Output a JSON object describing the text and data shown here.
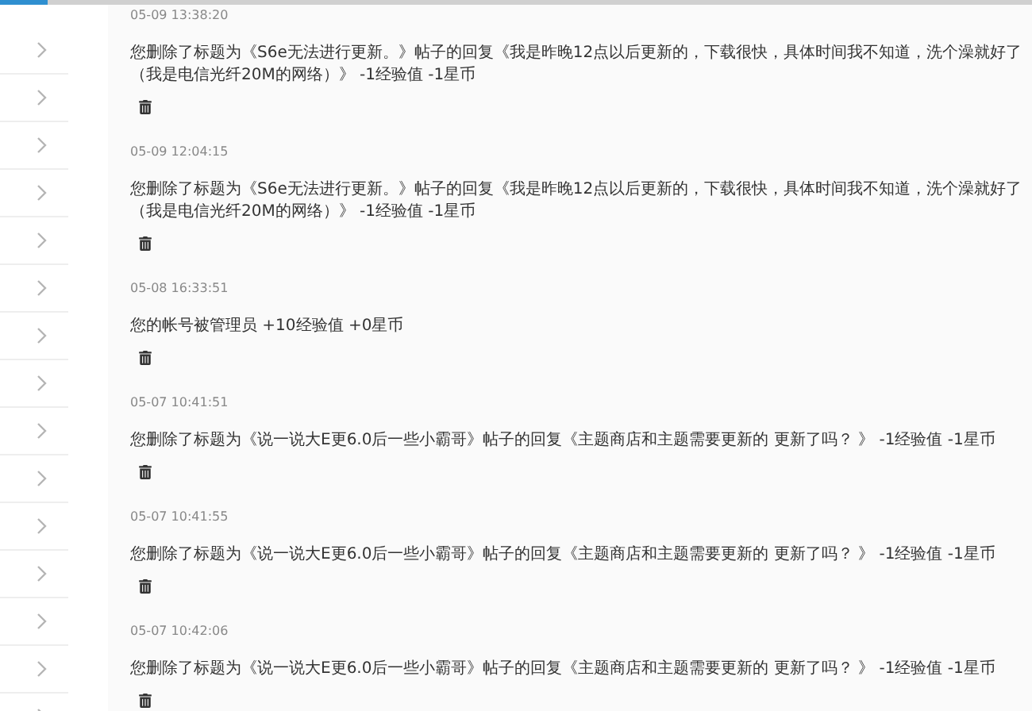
{
  "sidebar": {
    "items": [
      {
        "kind": "chevron"
      },
      {
        "kind": "chevron"
      },
      {
        "kind": "chevron"
      },
      {
        "kind": "chevron"
      },
      {
        "kind": "chevron"
      },
      {
        "kind": "chevron"
      },
      {
        "kind": "chevron"
      },
      {
        "kind": "chevron"
      },
      {
        "kind": "chevron"
      },
      {
        "kind": "chevron"
      },
      {
        "kind": "chevron"
      },
      {
        "kind": "chevron"
      },
      {
        "kind": "chevron"
      },
      {
        "kind": "chevron"
      },
      {
        "kind": "chevron"
      }
    ]
  },
  "entries": [
    {
      "time": "05-09 13:38:20",
      "text": "您删除了标题为《S6e无法进行更新。》帖子的回复《我是昨晚12点以后更新的，下载很快，具体时间我不知道，洗个澡就好了（我是电信光纤20M的网络）》 -1经验值 -1星币"
    },
    {
      "time": "05-09 12:04:15",
      "text": "您删除了标题为《S6e无法进行更新。》帖子的回复《我是昨晚12点以后更新的，下载很快，具体时间我不知道，洗个澡就好了（我是电信光纤20M的网络）》 -1经验值 -1星币"
    },
    {
      "time": "05-08 16:33:51",
      "text": "您的帐号被管理员 +10经验值 +0星币"
    },
    {
      "time": "05-07 10:41:51",
      "text": "您删除了标题为《说一说大E更6.0后一些小霸哥》帖子的回复《主题商店和主题需要更新的 更新了吗？ 》 -1经验值 -1星币"
    },
    {
      "time": "05-07 10:41:55",
      "text": "您删除了标题为《说一说大E更6.0后一些小霸哥》帖子的回复《主题商店和主题需要更新的 更新了吗？ 》 -1经验值 -1星币"
    },
    {
      "time": "05-07 10:42:06",
      "text": "您删除了标题为《说一说大E更6.0后一些小霸哥》帖子的回复《主题商店和主题需要更新的 更新了吗？ 》 -1经验值 -1星币"
    }
  ]
}
